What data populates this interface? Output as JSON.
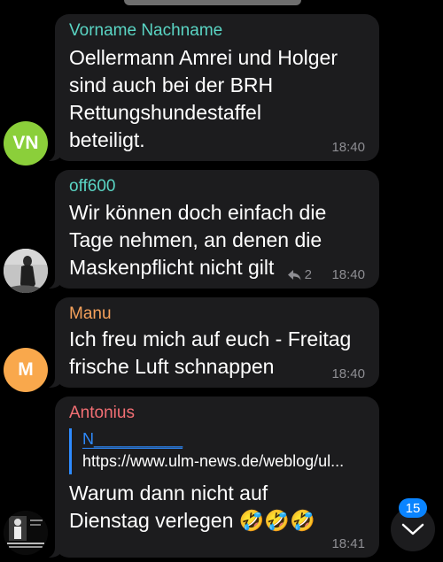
{
  "messages": [
    {
      "sender": "Vorname Nachname",
      "sender_color": "#5ad5c4",
      "lines": [
        "Oellermann Amrei und Holger",
        "sind auch bei der  BRH",
        "Rettungshundestaffel",
        "beteiligt."
      ],
      "time": "18:40",
      "avatar": {
        "initials": "VN",
        "color": "#8bcf3a"
      }
    },
    {
      "sender": "off600",
      "sender_color": "#5ad5c4",
      "lines": [
        "Wir können doch einfach die",
        "Tage nehmen, an denen die",
        "Maskenpflicht nicht gilt"
      ],
      "time": "18:40",
      "reply_count": "2",
      "avatar": {
        "icon": "photo-avatar"
      }
    },
    {
      "sender": "Manu",
      "sender_color": "#f5a15b",
      "lines": [
        "Ich freu mich auf euch - Freitag",
        "frische Luft schnappen"
      ],
      "time": "18:40",
      "avatar": {
        "initials": "M",
        "color": "#f9a84c"
      }
    },
    {
      "sender": "Antonius",
      "sender_color": "#f36f74",
      "quote": {
        "title": "N__________",
        "url": "https://www.ulm-news.de/weblog/ul..."
      },
      "lines": [
        "Warum dann nicht auf",
        "Dienstag verlegen 🤣🤣🤣"
      ],
      "time": "18:41",
      "avatar": {
        "icon": "image-avatar"
      }
    }
  ],
  "unread_badge": "15",
  "icons": {
    "reply": "reply-arrow-icon",
    "scroll": "chevron-down-icon"
  },
  "accent_color": "#0a84ff"
}
